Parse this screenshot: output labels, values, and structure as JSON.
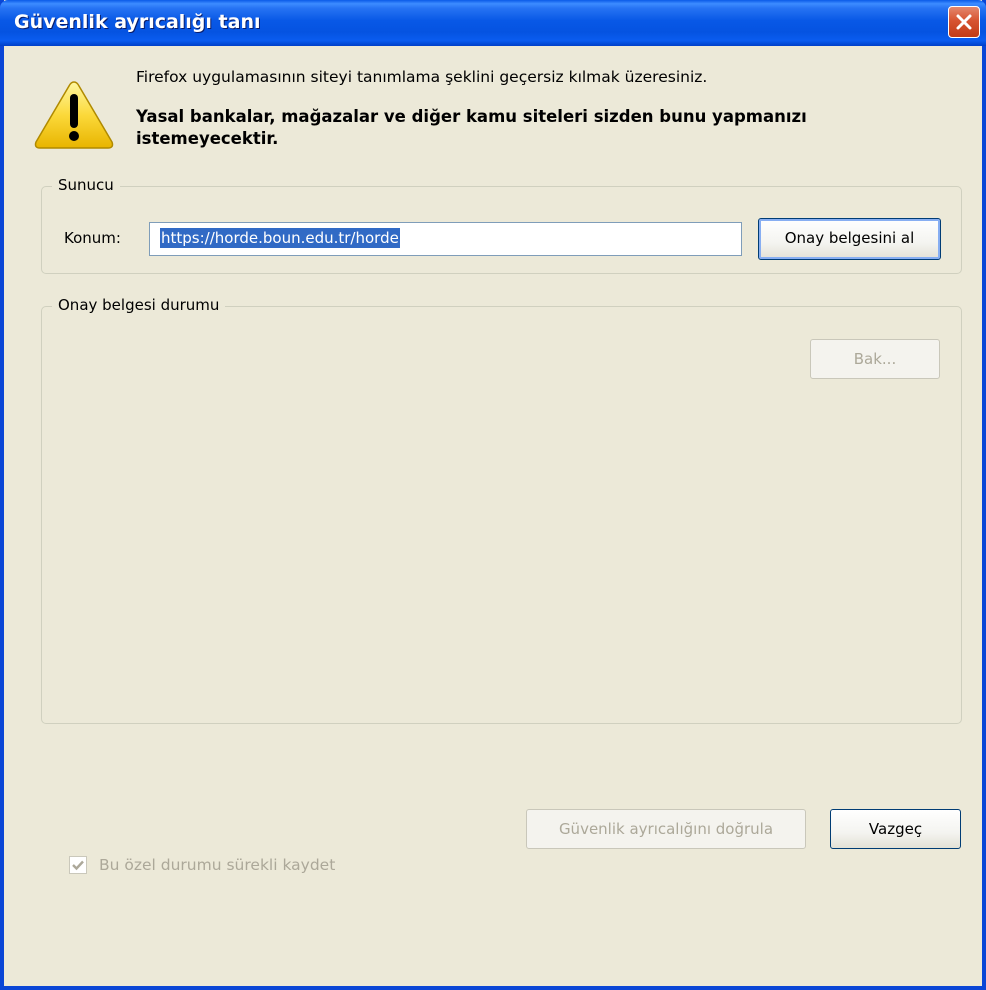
{
  "window": {
    "title": "Güvenlik ayrıcalığı tanı"
  },
  "message": {
    "intro": "Firefox uygulamasının siteyi tanımlama şeklini geçersiz kılmak üzeresiniz.",
    "warning": "Yasal bankalar, mağazalar ve diğer kamu siteleri sizden bunu yapmanızı istemeyecektir."
  },
  "server_group": {
    "legend": "Sunucu",
    "location_label": "Konum:",
    "location_value": "https://horde.boun.edu.tr/horde",
    "get_cert_button": "Onay belgesini al"
  },
  "status_group": {
    "legend": "Onay belgesi durumu",
    "view_button": "Bak...",
    "view_button_enabled": false,
    "remember_label": "Bu özel durumu sürekli kaydet",
    "remember_checked": true,
    "remember_enabled": false
  },
  "footer": {
    "confirm_button": "Güvenlik ayrıcalığını doğrula",
    "confirm_enabled": false,
    "cancel_button": "Vazgeç"
  },
  "icons": {
    "warning": "warning-triangle-icon",
    "close": "close-icon",
    "check": "checkmark-icon"
  },
  "colors": {
    "titlebar": "#0858e6",
    "dialog_bg": "#ece9d8",
    "selection": "#316ac5",
    "close_button": "#d75431",
    "warning_yellow": "#fdd835",
    "disabled_text": "#aca899"
  }
}
